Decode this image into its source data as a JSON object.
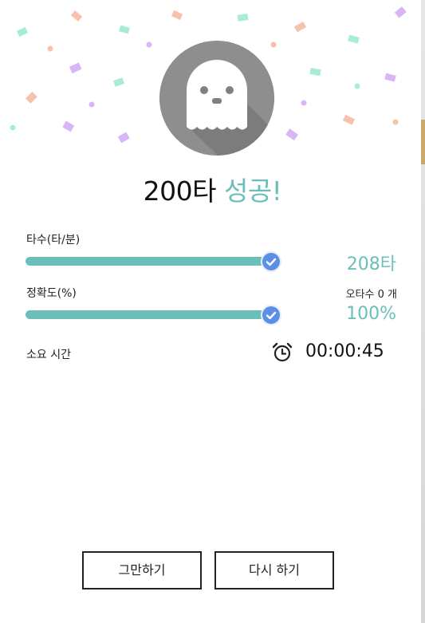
{
  "result": {
    "target": "200타",
    "status": "성공!"
  },
  "stats": {
    "speed": {
      "label": "타수(타/분)",
      "value": "208타",
      "progress": 1.0
    },
    "accuracy": {
      "label": "정확도(%)",
      "value": "100%",
      "progress": 1.0
    },
    "typos": {
      "label": "오타수",
      "count": "0",
      "unit": "개"
    },
    "elapsed": {
      "label": "소요 시간",
      "value": "00:00:45"
    }
  },
  "buttons": {
    "stop": "그만하기",
    "retry": "다시 하기"
  },
  "colors": {
    "accent": "#6abfb9",
    "bar": "#6bbfbb",
    "check": "#5b8fe6",
    "avatar": "#8e8e8e"
  },
  "icons": [
    "ghost-icon",
    "check-icon",
    "alarm-clock-icon"
  ]
}
